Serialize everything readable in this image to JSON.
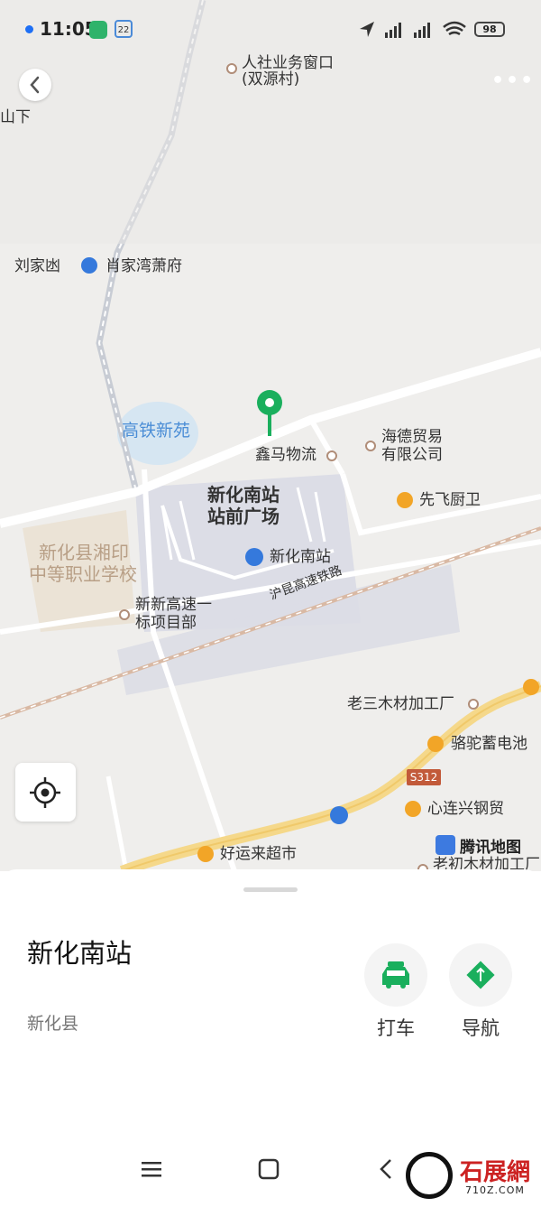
{
  "status_bar": {
    "time": "11:05",
    "calendar_day": "22",
    "battery": "98"
  },
  "map": {
    "labels": {
      "hrss_window_1": "人社业务窗口",
      "hrss_window_2": "(双源村)",
      "shanxia": "山下",
      "liujiaxiao": "刘家凼",
      "xiaojiawan": "肖家湾萧府",
      "gaotie_xinyuan": "高铁新苑",
      "xinma": "鑫马物流",
      "haide_1": "海德贸易",
      "haide_2": "有限公司",
      "xianfei": "先飞厨卫",
      "square_1": "新化南站",
      "square_2": "站前广场",
      "school_1": "新化县湘印",
      "school_2": "中等职业学校",
      "station": "新化南站",
      "xinxin_1": "新新高速一",
      "xinxin_2": "标项目部",
      "railway": "沪昆高速铁路",
      "laosan": "老三木材加工厂",
      "luotuo": "骆驼蓄电池",
      "xinlianxing": "心连兴钢贸",
      "haoyunlai": "好运来超市",
      "laochu": "老初木材加工厂",
      "road_shield": "S312",
      "brand": "腾讯地图"
    }
  },
  "sheet": {
    "title": "新化南站",
    "subtitle": "新化县",
    "actions": {
      "taxi": "打车",
      "navigate": "导航"
    }
  },
  "watermark": {
    "name": "石展網",
    "url": "710Z.COM"
  },
  "colors": {
    "accent_green": "#1aaf5d",
    "map_bg": "#efeeec",
    "road_yellow": "#f5d88a",
    "poi_orange": "#f2a527"
  }
}
